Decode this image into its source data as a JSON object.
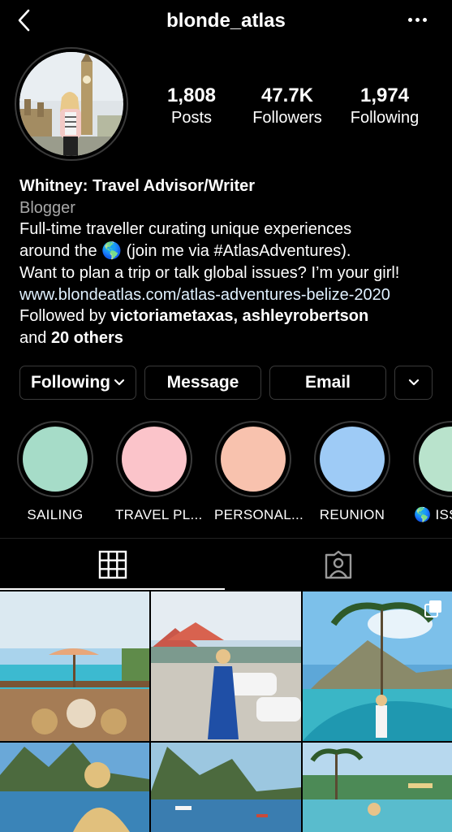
{
  "header": {
    "username": "blonde_atlas"
  },
  "stats": [
    {
      "value": "1,808",
      "label": "Posts"
    },
    {
      "value": "47.7K",
      "label": "Followers"
    },
    {
      "value": "1,974",
      "label": "Following"
    }
  ],
  "bio": {
    "name": "Whitney: Travel Advisor/Writer",
    "category": "Blogger",
    "line1": "Full-time traveller curating unique experiences",
    "line2a": "around the",
    "globe": "🌎",
    "line2b": "(join me via #AtlasAdventures).",
    "line3": "Want to plan a trip or talk global issues? I’m your girl!",
    "link": "www.blondeatlas.com/atlas-adventures-belize-2020",
    "followed_prefix": "Followed by",
    "followed_users": "victoriametaxas, ashleyrobertson",
    "followed_and": "and",
    "followed_others": "20 others"
  },
  "buttons": {
    "following": "Following",
    "message": "Message",
    "email": "Email"
  },
  "highlights": [
    {
      "label": "SAILING",
      "color": "#a6dcc8"
    },
    {
      "label": "TRAVEL PL...",
      "color": "#fbc4ca"
    },
    {
      "label": "PERSONAL...",
      "color": "#f8c2ae"
    },
    {
      "label": "REUNION",
      "color": "#9ecbf6"
    },
    {
      "label": "🌎 ISS",
      "color": "#b9e3cc"
    }
  ],
  "colors": {
    "background": "#000000",
    "link": "#e0f1ff",
    "muted": "#a8a8a8",
    "border": "#3a3a3a"
  },
  "icons": [
    "back-chevron-icon",
    "more-options-icon",
    "chevron-down-icon",
    "grid-icon",
    "tagged-icon",
    "multiple-posts-icon"
  ]
}
